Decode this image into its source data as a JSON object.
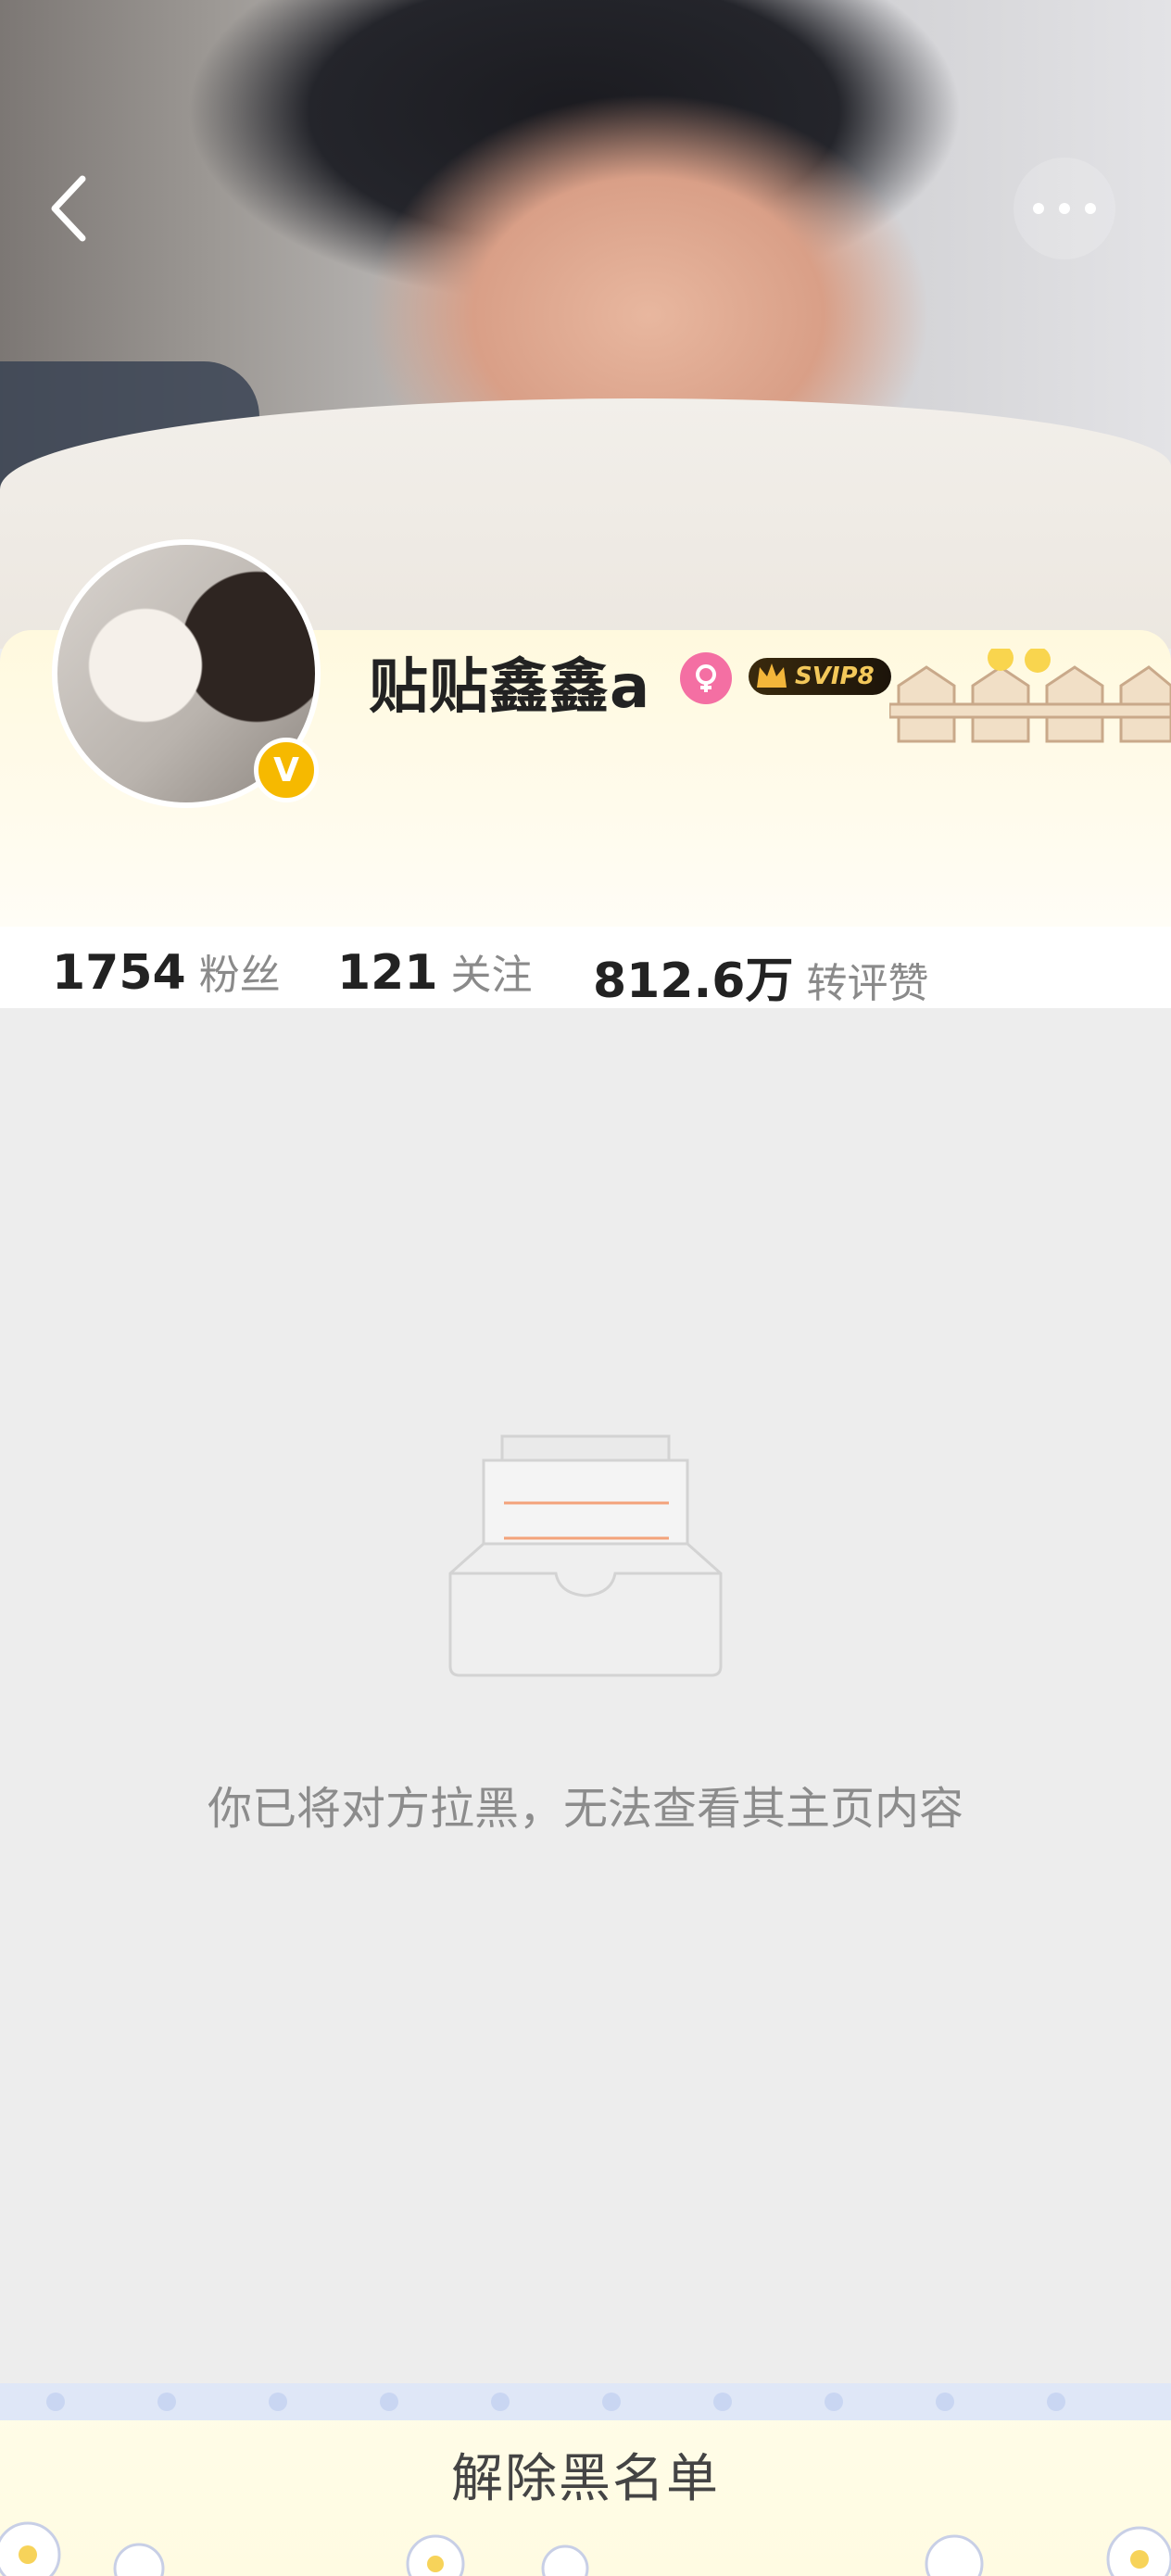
{
  "header": {
    "back_icon": "back-chevron-icon",
    "more_icon": "more-dots-icon"
  },
  "profile": {
    "name": "贴贴鑫鑫a",
    "verified_badge": "V",
    "gender_icon": "female-icon",
    "vip_badge": "SVIP8",
    "accent": "#f6b900"
  },
  "stats": [
    {
      "value": "1754",
      "label": "粉丝"
    },
    {
      "value": "121",
      "label": "关注"
    },
    {
      "value": "812.6万",
      "label": "转评赞"
    }
  ],
  "empty_state": {
    "icon": "empty-inbox-icon",
    "message": "你已将对方拉黑，无法查看其主页内容"
  },
  "footer": {
    "unblock_label": "解除黑名单"
  }
}
